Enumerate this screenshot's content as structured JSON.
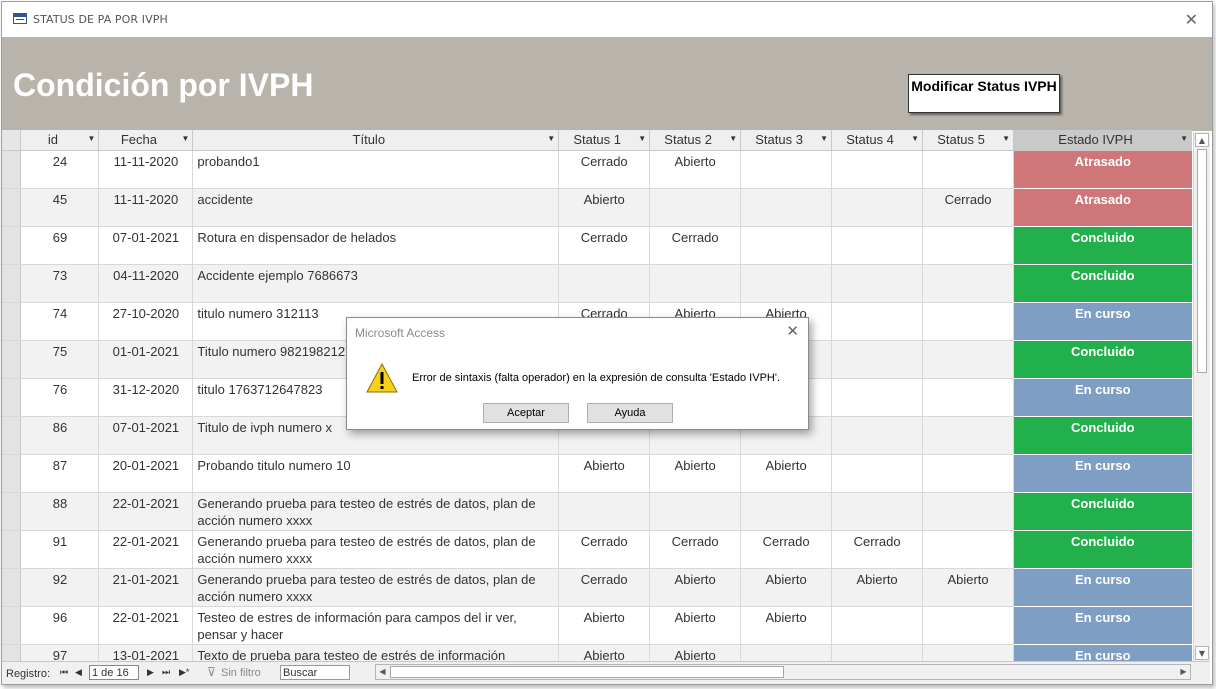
{
  "window": {
    "title": "STATUS DE PA POR IVPH",
    "close_glyph": "✕"
  },
  "header": {
    "heading": "Condición por IVPH",
    "modify_button": "Modificar Status IVPH"
  },
  "table": {
    "columns": [
      "id",
      "Fecha",
      "Título",
      "Status 1",
      "Status 2",
      "Status 3",
      "Status 4",
      "Status 5",
      "Estado IVPH"
    ],
    "rows": [
      {
        "id": "24",
        "fecha": "11-11-2020",
        "titulo": "probando1",
        "s1": "Cerrado",
        "s2": "Abierto",
        "s3": "",
        "s4": "",
        "s5": "",
        "estado": "Atrasado"
      },
      {
        "id": "45",
        "fecha": "11-11-2020",
        "titulo": "accidente",
        "s1": "Abierto",
        "s2": "",
        "s3": "",
        "s4": "",
        "s5": "Cerrado",
        "estado": "Atrasado"
      },
      {
        "id": "69",
        "fecha": "07-01-2021",
        "titulo": "Rotura en dispensador de helados",
        "s1": "Cerrado",
        "s2": "Cerrado",
        "s3": "",
        "s4": "",
        "s5": "",
        "estado": "Concluido"
      },
      {
        "id": "73",
        "fecha": "04-11-2020",
        "titulo": "Accidente ejemplo 7686673",
        "s1": "",
        "s2": "",
        "s3": "",
        "s4": "",
        "s5": "",
        "estado": "Concluido"
      },
      {
        "id": "74",
        "fecha": "27-10-2020",
        "titulo": "titulo numero 312113",
        "s1": "Cerrado",
        "s2": "Abierto",
        "s3": "Abierto",
        "s4": "",
        "s5": "",
        "estado": "En curso"
      },
      {
        "id": "75",
        "fecha": "01-01-2021",
        "titulo": "Titulo numero 982198212",
        "s1": "",
        "s2": "",
        "s3": "",
        "s4": "",
        "s5": "",
        "estado": "Concluido"
      },
      {
        "id": "76",
        "fecha": "31-12-2020",
        "titulo": "titulo 1763712647823",
        "s1": "",
        "s2": "",
        "s3": "",
        "s4": "",
        "s5": "",
        "estado": "En curso"
      },
      {
        "id": "86",
        "fecha": "07-01-2021",
        "titulo": "Titulo de ivph numero x",
        "s1": "",
        "s2": "",
        "s3": "",
        "s4": "",
        "s5": "",
        "estado": "Concluido"
      },
      {
        "id": "87",
        "fecha": "20-01-2021",
        "titulo": "Probando titulo numero 10",
        "s1": "Abierto",
        "s2": "Abierto",
        "s3": "Abierto",
        "s4": "",
        "s5": "",
        "estado": "En curso"
      },
      {
        "id": "88",
        "fecha": "22-01-2021",
        "titulo": "Generando prueba para testeo de estrés de datos, plan de acción numero xxxx",
        "s1": "",
        "s2": "",
        "s3": "",
        "s4": "",
        "s5": "",
        "estado": "Concluido"
      },
      {
        "id": "91",
        "fecha": "22-01-2021",
        "titulo": "Generando prueba para testeo de estrés de datos, plan de acción numero xxxx",
        "s1": "Cerrado",
        "s2": "Cerrado",
        "s3": "Cerrado",
        "s4": "Cerrado",
        "s5": "",
        "estado": "Concluido"
      },
      {
        "id": "92",
        "fecha": "21-01-2021",
        "titulo": "Generando prueba para testeo de estrés de datos, plan de acción numero xxxx",
        "s1": "Cerrado",
        "s2": "Abierto",
        "s3": "Abierto",
        "s4": "Abierto",
        "s5": "Abierto",
        "estado": "En curso"
      },
      {
        "id": "96",
        "fecha": "22-01-2021",
        "titulo": "Testeo de estres de información para campos del ir ver, pensar y hacer",
        "s1": "Abierto",
        "s2": "Abierto",
        "s3": "Abierto",
        "s4": "",
        "s5": "",
        "estado": "En curso"
      },
      {
        "id": "97",
        "fecha": "13-01-2021",
        "titulo": "Texto de prueba para testeo de estrés de información",
        "s1": "Abierto",
        "s2": "Abierto",
        "s3": "",
        "s4": "",
        "s5": "",
        "estado": "En curso"
      }
    ]
  },
  "estado_colors": {
    "Atrasado": "#cf7678",
    "Concluido": "#21b04b",
    "En curso": "#7f9ec4"
  },
  "navbar": {
    "record_label": "Registro:",
    "first": "⏮",
    "prev": "◀",
    "position": "1 de 16",
    "next": "▶",
    "last": "⏭",
    "new": "▶*",
    "filter": "Sin filtro",
    "search": "Buscar"
  },
  "dialog": {
    "title": "Microsoft Access",
    "message": "Error de sintaxis (falta operador) en la expresión de consulta 'Estado IVPH'.",
    "ok_button": "Aceptar",
    "help_button": "Ayuda"
  }
}
